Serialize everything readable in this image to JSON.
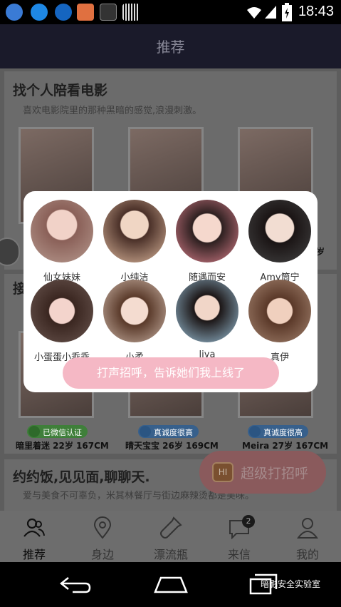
{
  "status_bar": {
    "time": "18:43",
    "icons": [
      "app-icon-1",
      "app-icon-2",
      "app-icon-3",
      "app-icon-4",
      "bug-icon",
      "barcode-icon",
      "wifi-icon",
      "signal-icon",
      "battery-icon"
    ]
  },
  "app": {
    "title": "推荐"
  },
  "sections": [
    {
      "title": "找个人陪看电影",
      "desc": "喜欢电影院里的那种黑暗的感觉,浪漫刺激。"
    },
    {
      "title": "接",
      "people": [
        {
          "badge": "已微信认证",
          "info": "暗里着迷  22岁 167CM"
        },
        {
          "badge": "真诚度很高",
          "info": "晴天宝宝  26岁 169CM"
        },
        {
          "badge": "真诚度很高",
          "info": "Meira  27岁 167CM"
        }
      ]
    },
    {
      "title": "约约饭,见见面,聊聊天.",
      "desc": "爱与美食不可辜负，米其林餐厅与街边麻辣烫都是美味。"
    }
  ],
  "partial_text": "岁",
  "hi_button": {
    "badge": "HI",
    "label": "超级打招呼"
  },
  "modal": {
    "users": [
      {
        "name": "仙女妹妹"
      },
      {
        "name": "小纯洁"
      },
      {
        "name": "随遇而安"
      },
      {
        "name": "Amy筒宁"
      },
      {
        "name": "小蛋蛋小乖乖"
      },
      {
        "name": "小柔"
      },
      {
        "name": "liya"
      },
      {
        "name": "真伊"
      }
    ],
    "greet_button": "打声招呼，告诉她们我上线了"
  },
  "bottom_nav": [
    {
      "label": "推荐",
      "icon": "people-icon",
      "active": true
    },
    {
      "label": "身边",
      "icon": "location-pin-icon"
    },
    {
      "label": "漂流瓶",
      "icon": "bottle-icon"
    },
    {
      "label": "来信",
      "icon": "message-icon",
      "badge": "2"
    },
    {
      "label": "我的",
      "icon": "profile-icon"
    }
  ],
  "system_nav": {
    "watermark": "暗影安全实验室"
  },
  "colors": {
    "accent_pink": "#f5b8c5",
    "header_bg": "#1a1a2a"
  }
}
